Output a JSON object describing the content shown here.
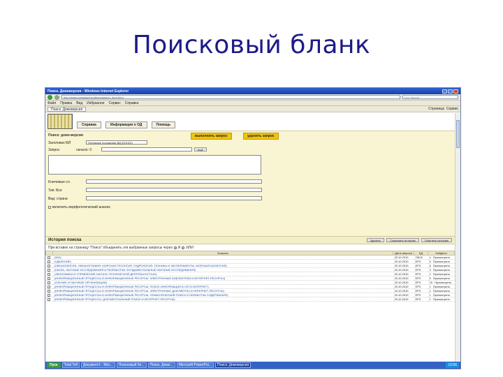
{
  "slide": {
    "title": "Поисковый бланк"
  },
  "window": {
    "title": "Поиск. Демоверсия - Windows Internet Explorer",
    "url": "http://www.consultant.ru/demo/search_form.html",
    "search_placeholder": "Live Search",
    "menu": [
      "Файл",
      "Правка",
      "Вид",
      "Избранное",
      "Сервис",
      "Справка"
    ],
    "tab": "Поиск. Демоверсия",
    "toolbar_right": [
      "Страница",
      "Сервис"
    ]
  },
  "app": {
    "nav_buttons": [
      "Справка",
      "Информация о ОД",
      "Помощь"
    ],
    "form_heading": "Поиск: демо-версия",
    "execute_button": "выполнить запрос",
    "delete_button": "удалить запрос",
    "fields": {
      "section_label": "Заголовок МЛ",
      "section_value": "Основные положения ВД (010101)",
      "query_label": "Запрос",
      "start_label": "начало: 0",
      "more_label": "ещё",
      "keywords_label": "Ключевые сл.",
      "type_label": "Тип: Все",
      "kind_label": "Вид: страна",
      "checkbox_label": "включить морфологический анализ"
    }
  },
  "history": {
    "title": "История поиска",
    "buttons": [
      "Удалить",
      "Сохранить историю",
      "Очистить историю"
    ],
    "hint": "При вставке на страницу \"Поиск\" объединить эти выбранные запросы через",
    "radio_and": "И",
    "radio_or": "ИЛИ",
    "columns": [
      "Запросы",
      "Дата запроса",
      "БД",
      "Найдено"
    ],
    "rows": [
      {
        "query": "(ЗАЗ)",
        "date": "20.10.2010",
        "db": "ОБЧ2",
        "count": "4",
        "action": "Просмотреть"
      },
      {
        "query": "(УДАЛЕНИЕ)",
        "date": "20.10.2010",
        "db": "ЕРЗ",
        "count": "6",
        "action": "Просмотреть"
      },
      {
        "query": "(ОКЕАНОЛОГИЯ, ОКЕАНОГРАФИЯ, МОРСКАЯ ГЕОЛОГИЯ, ГИДРОЛОГИЯ: ТЕХНИКА И ЭКСПЕРИМЕНТЫ, МОРСКАЯ БИОЛОГИЯ)",
        "date": "20.10.2010",
        "db": "ЕРЗ",
        "count": "8",
        "action": "Просмотреть"
      },
      {
        "query": "(НАУКА, НАУЧНЫЕ ИССЛЕДОВАНИЯ И РАЗРАБОТКИ: ФУНДАМЕНТАЛЬНЫЕ НАУЧНЫЕ ИССЛЕДОВАНИЯ)",
        "date": "20.10.2010",
        "db": "ЕРЗ",
        "count": "3",
        "action": "Просмотреть"
      },
      {
        "query": "(ЭКОНОМИКА И УПРАВЛЕНИЕ НАУЧНО-ТЕХНИЧЕСКОЙ ДЕЯТЕЛЬНОСТЬЮ)",
        "date": "20.10.2010",
        "db": "ЕРЗ",
        "count": "2",
        "action": "Просмотреть"
      },
      {
        "query": "(ИНФОРМАЦИОННЫЕ ПРОЦЕССЫ И ИНФОРМАЦИОННЫЕ РЕСУРСЫ: ЭЛЕКТРОННЫЕ БИБЛИОТЕКИ И ИНТЕРНЕТ-РЕСУРСЫ)",
        "date": "20.10.2010",
        "db": "ЕРЗ",
        "count": "5",
        "action": "Просмотреть"
      },
      {
        "query": "(УЧЕНЫЕ И НАУЧНЫЕ ОРГАНИЗАЦИИ)",
        "date": "20.10.2010",
        "db": "ЕРЗ",
        "count": "15",
        "action": "Просмотреть"
      },
      {
        "query": "(ИНФОРМАЦИОННЫЕ ПРОЦЕССЫ И ИНФОРМАЦИОННЫЕ РЕСУРСЫ: ПОИСК ИНФОРМАЦИИ В СЕТИ ИНТЕРНЕТ)",
        "date": "20.10.2010",
        "db": "ЕРЗ",
        "count": "1",
        "action": "Просмотреть"
      },
      {
        "query": "(ИНФОРМАЦИОННЫЕ ПРОЦЕССЫ И ИНФОРМАЦИОННЫЕ РЕСУРСЫ: ЭЛЕКТРОННЫЕ ДОКУМЕНТЫ И ИНТЕРНЕТ-РЕСУРСЫ)",
        "date": "20.10.2010",
        "db": "ЕРЗ",
        "count": "1",
        "action": "Просмотреть"
      },
      {
        "query": "(ИНФОРМАЦИОННЫЕ ПРОЦЕССЫ И ИНФОРМАЦИОННЫЕ РЕСУРСЫ: СЕМАНТИЧЕСКИЙ ПОИСК И ОБРАБОТКА СОДЕРЖАНИЯ)",
        "date": "20.10.2010",
        "db": "ЕРЗ",
        "count": "1",
        "action": "Просмотреть"
      },
      {
        "query": "(ИНФОРМАЦИОННЫЕ ПРОЦЕССЫ: ДОКУМЕНТАЛЬНЫЙ ПОИСК И ИНТЕРНЕТ-РЕСУРСЫ)",
        "date": "20.10.2010",
        "db": "ЕРЗ",
        "count": "1",
        "action": "Просмотреть"
      }
    ]
  },
  "taskbar": {
    "start": "Пуск",
    "tasks": [
      "Total Tell",
      "Документ1 - Micr...",
      "Поисковый бл...",
      "Поиск. Демо...",
      "Microsoft PowerPoi...",
      "Поиск: Демоверсия"
    ],
    "clock": "12:06"
  }
}
